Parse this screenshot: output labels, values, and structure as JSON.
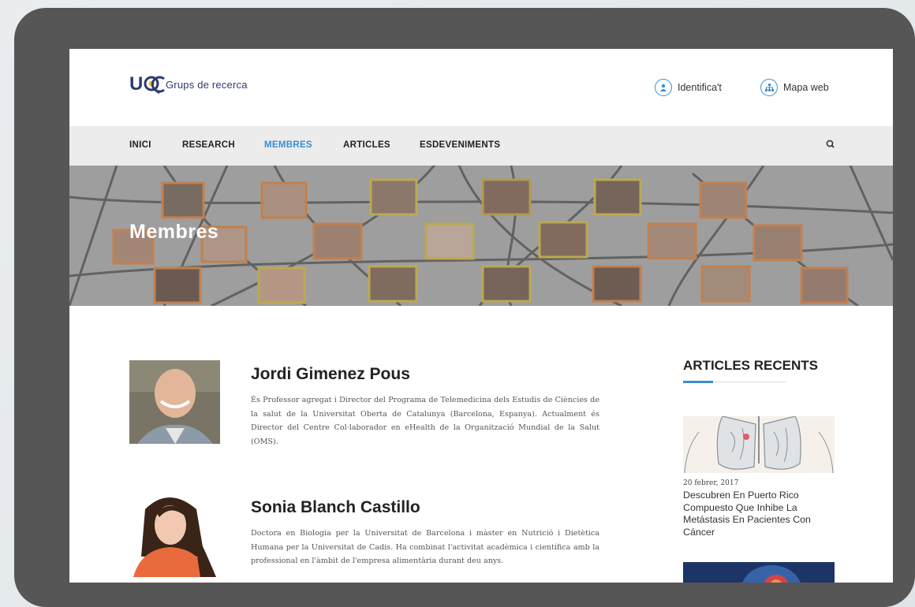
{
  "header": {
    "logo_text": "Grups de recerca",
    "login_label": "Identifica't",
    "sitemap_label": "Mapa web"
  },
  "nav": {
    "items": [
      {
        "label": "INICI",
        "active": false
      },
      {
        "label": "RESEARCH",
        "active": false
      },
      {
        "label": "MEMBRES",
        "active": true
      },
      {
        "label": "ARTICLES",
        "active": false
      },
      {
        "label": "ESDEVENIMENTS",
        "active": false
      }
    ],
    "search_icon": "search-icon"
  },
  "banner": {
    "title": "Membres"
  },
  "members": [
    {
      "name": "Jordi Gimenez Pous",
      "bio": "És Professor agregat i Director del Programa de Telemedicina dels Estudis de Ciències de la salut de la Universitat Oberta de Catalunya (Barcelona, Espanya). Actualment és Director del Centre Col·laborador en eHealth de la Organització Mundial de la Salut (OMS)."
    },
    {
      "name": "Sonia Blanch Castillo",
      "bio": "Doctora en Biologia per la Universitat de Barcelona i màster en Nutrició i Dietètica Humana per la Universitat de Cadis. Ha combinat l'activitat acadèmica i científica amb la professional en l'àmbit de l'empresa alimentària durant deu anys."
    }
  ],
  "sidebar": {
    "title": "ARTICLES RECENTS",
    "articles": [
      {
        "date": "20 febrer, 2017",
        "title": "Descubren En Puerto Rico Compuesto Que Inhibe La Metástasis En Pacientes Con Cáncer"
      }
    ]
  },
  "colors": {
    "accent": "#3a8ed0",
    "frame": "#565656",
    "nav_bg": "#ececec"
  }
}
